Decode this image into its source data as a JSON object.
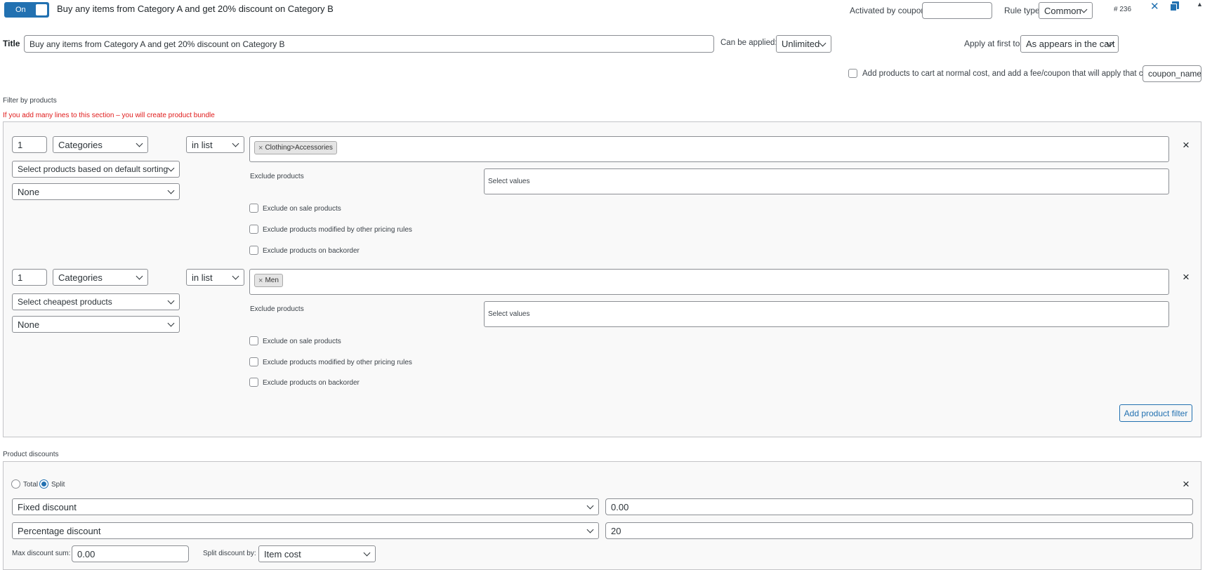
{
  "header": {
    "toggle_label": "On",
    "rule_title": "Buy any items from Category A and get 20% discount on Category B",
    "activated_by_coupon_label": "Activated by coupon",
    "activated_by_coupon_value": "",
    "rule_type_label": "Rule type",
    "rule_type_value": "Common",
    "rule_id": "# 236",
    "close_glyph": "✕",
    "collapse_glyph": "▲"
  },
  "title_row": {
    "title_label": "Title",
    "title_value": "Buy any items from Category A and get 20% discount on Category B",
    "can_be_applied_label": "Can be applied:",
    "can_be_applied_value": "Unlimited",
    "apply_first_label": "Apply at first to:",
    "apply_first_value": "As appears in the cart"
  },
  "fee_row": {
    "checkbox_label": "Add products to cart at normal cost, and add a fee/coupon that will apply that cost",
    "coupon_value": "coupon_name"
  },
  "filter_section": {
    "heading": "Filter by products",
    "warning": "If you add many lines to this section – you will create product bundle",
    "warning_color": "#e01b1b",
    "filters": [
      {
        "qty": "1",
        "type": "Categories",
        "operator": "in list",
        "tags": [
          "Clothing>Accessories"
        ],
        "sorting": "Select products based on default sorting",
        "limit": "None",
        "exclude_products_label": "Exclude products",
        "exclude_placeholder": "Select values",
        "exclude_on_sale": "Exclude on sale products",
        "exclude_modified": "Exclude products modified by other pricing rules",
        "exclude_backorder": "Exclude products on backorder"
      },
      {
        "qty": "1",
        "type": "Categories",
        "operator": "in list",
        "tags": [
          "Men"
        ],
        "sorting": "Select cheapest products",
        "limit": "None",
        "exclude_products_label": "Exclude products",
        "exclude_placeholder": "Select values",
        "exclude_on_sale": "Exclude on sale products",
        "exclude_modified": "Exclude products modified by other pricing rules",
        "exclude_backorder": "Exclude products on backorder"
      }
    ],
    "add_button": "Add product filter"
  },
  "discount_section": {
    "heading": "Product discounts",
    "radio_total": "Total",
    "radio_split": "Split",
    "selected": "Split",
    "rows": [
      {
        "type": "Fixed discount",
        "value": "0.00"
      },
      {
        "type": "Percentage discount",
        "value": "20"
      }
    ],
    "max_sum_label": "Max discount sum:",
    "max_sum_value": "0.00",
    "split_by_label": "Split discount by:",
    "split_by_value": "Item cost"
  },
  "icons": {
    "close": "close-icon",
    "copy": "copy-icon",
    "collapse": "collapse-arrow-icon",
    "remove": "remove-x-icon",
    "chevron": "chevron-down-icon"
  },
  "colors": {
    "accent": "#2271b1",
    "warning": "#e01b1b",
    "border": "#8c8f94"
  }
}
